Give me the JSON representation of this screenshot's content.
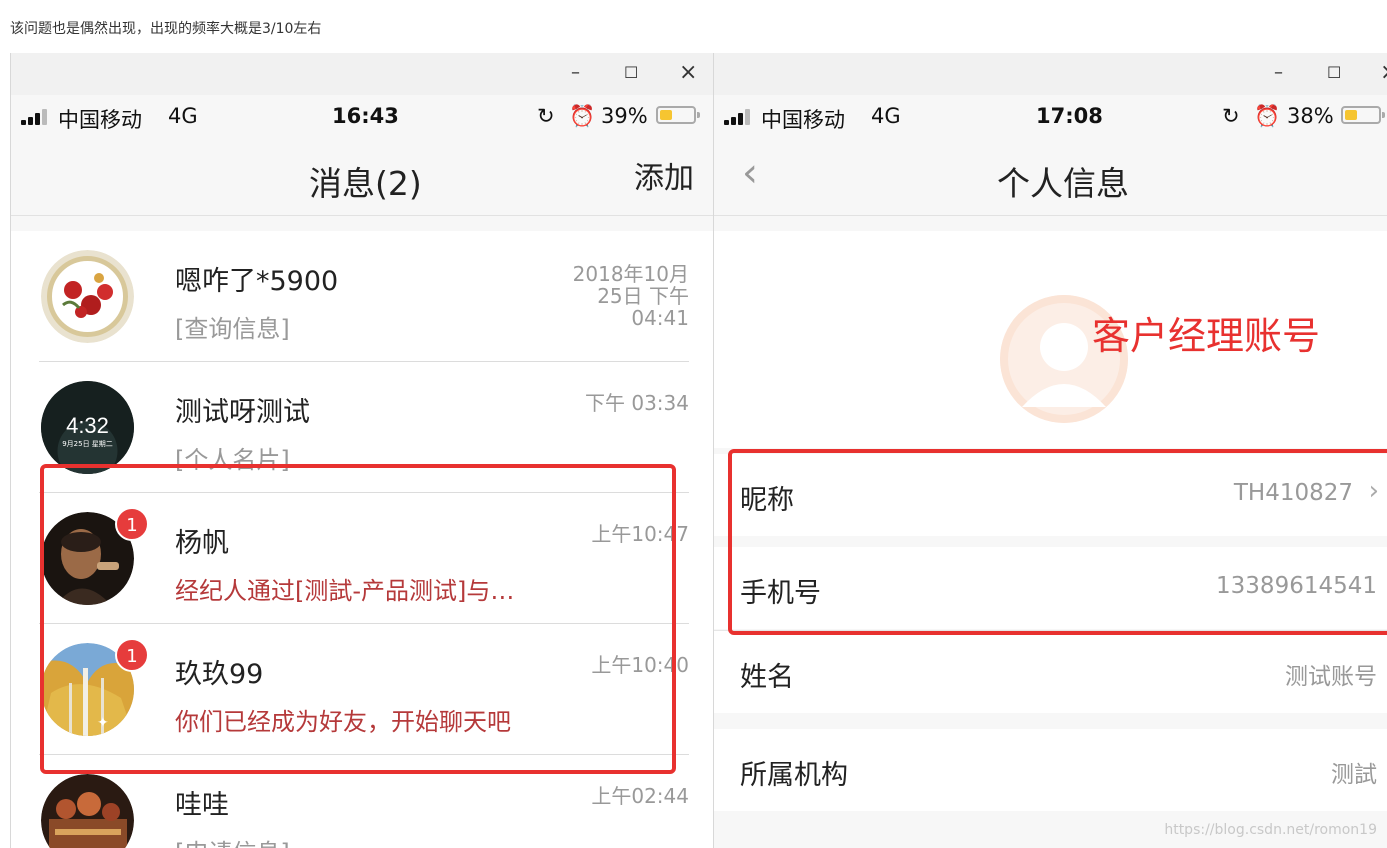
{
  "caption": "该问题也是偶然出现，出现的频率大概是3/10左右",
  "window_controls": {
    "minimize": "–",
    "maximize": "☐",
    "close": "×"
  },
  "left_phone": {
    "status": {
      "carrier": "中国移动",
      "network": "4G",
      "time": "16:43",
      "battery": "39%",
      "battery_level": 0.39
    },
    "nav": {
      "title": "消息(2)",
      "action": "添加"
    },
    "items": [
      {
        "name": "嗯咋了*5900",
        "subtitle": "[查询信息]",
        "time_line1": "2018年10月",
        "time_line2": "25日 下午",
        "time_line3": "04:41",
        "badge": ""
      },
      {
        "name": "测试呀测试",
        "subtitle": "[个人名片]",
        "time_line1": "下午 03:34",
        "time_line2": "",
        "time_line3": "",
        "badge": "",
        "avatar_clock": "4:32",
        "avatar_date": "9月25日 星期二"
      },
      {
        "name": "杨帆",
        "subtitle": "经纪人通过[测試-产品测试]与…",
        "time_line1": "上午10:47",
        "time_line2": "",
        "time_line3": "",
        "badge": "1"
      },
      {
        "name": "玖玖99",
        "subtitle": "你们已经成为好友，开始聊天吧",
        "time_line1": "上午10:40",
        "time_line2": "",
        "time_line3": "",
        "badge": "1"
      },
      {
        "name": "哇哇",
        "subtitle": "[申请信息]",
        "time_line1": "上午02:44",
        "time_line2": "",
        "time_line3": "",
        "badge": ""
      }
    ]
  },
  "right_phone": {
    "status": {
      "carrier": "中国移动",
      "network": "4G",
      "time": "17:08",
      "battery": "38%",
      "battery_level": 0.38
    },
    "nav": {
      "title": "个人信息"
    },
    "annotation": "客户经理账号",
    "fields": [
      {
        "label": "昵称",
        "value": "TH410827"
      },
      {
        "label": "手机号",
        "value": "13389614541"
      },
      {
        "label": "姓名",
        "value": "测试账号"
      },
      {
        "label": "所属机构",
        "value": "测試"
      }
    ]
  },
  "watermark": "https://blog.csdn.net/romon19",
  "colors": {
    "highlight": "#e8312f",
    "badge": "#e63c3c",
    "red_text": "#b5393a",
    "battery": "#f6c531"
  }
}
